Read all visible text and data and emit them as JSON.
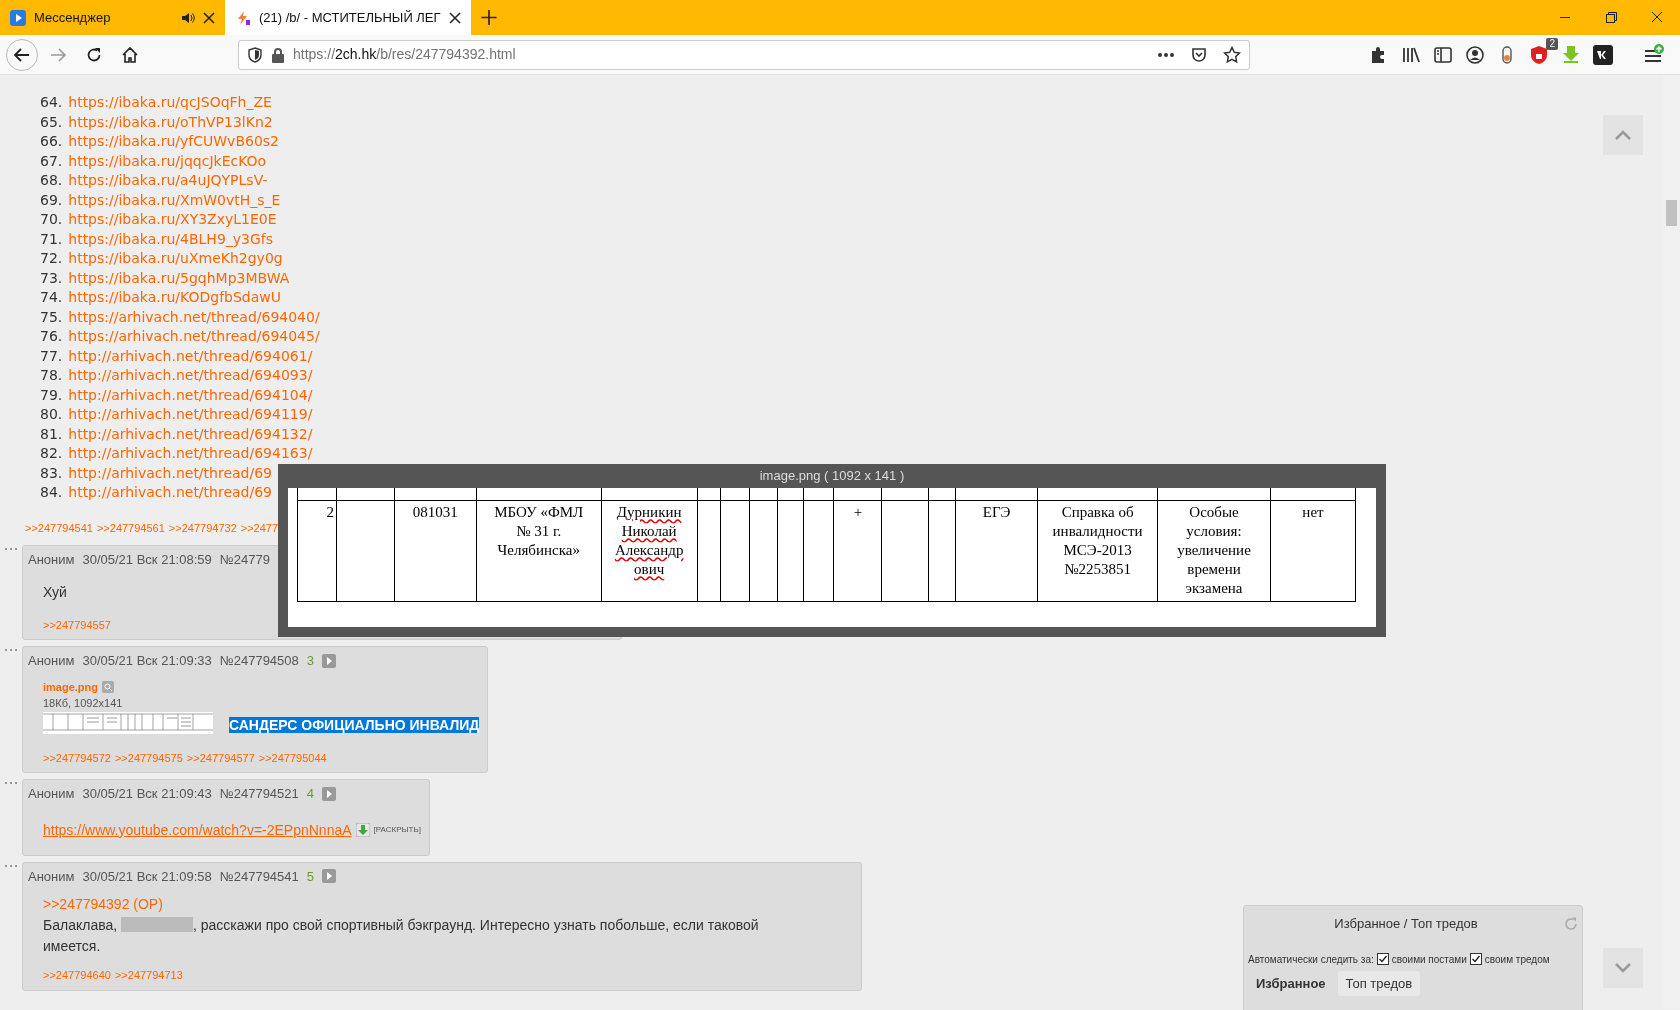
{
  "browser": {
    "tabs": [
      {
        "title": "Мессенджер",
        "selected": false,
        "audio": true
      },
      {
        "title": "(21) /b/ - МСТИТЕЛЬНЫЙ ЛЕГ",
        "selected": true,
        "audio": false
      }
    ],
    "url": {
      "scheme": "https://",
      "host": "2ch.hk",
      "path": "/b/res/247794392.html"
    },
    "extension_badge": "2"
  },
  "link_list": [
    {
      "number": "64.",
      "url": "https://ibaka.ru/qcJSOqFh_ZE"
    },
    {
      "number": "65.",
      "url": "https://ibaka.ru/oThVP13lKn2"
    },
    {
      "number": "66.",
      "url": "https://ibaka.ru/yfCUWvB60s2"
    },
    {
      "number": "67.",
      "url": "https://ibaka.ru/jqqcJkEcKOo"
    },
    {
      "number": "68.",
      "url": "https://ibaka.ru/a4uJQYPLsV-"
    },
    {
      "number": "69.",
      "url": "https://ibaka.ru/XmW0vtH_s_E"
    },
    {
      "number": "70.",
      "url": "https://ibaka.ru/XY3ZxyL1E0E"
    },
    {
      "number": "71.",
      "url": "https://ibaka.ru/4BLH9_y3Gfs"
    },
    {
      "number": "72.",
      "url": "https://ibaka.ru/uXmeKh2gy0g"
    },
    {
      "number": "73.",
      "url": "https://ibaka.ru/5gqhMp3MBWA"
    },
    {
      "number": "74.",
      "url": "https://ibaka.ru/KODgfbSdawU"
    },
    {
      "number": "75.",
      "url": "https://arhivach.net/thread/694040/"
    },
    {
      "number": "76.",
      "url": "https://arhivach.net/thread/694045/"
    },
    {
      "number": "77.",
      "url": "http://arhivach.net/thread/694061/"
    },
    {
      "number": "78.",
      "url": "http://arhivach.net/thread/694093/"
    },
    {
      "number": "79.",
      "url": "http://arhivach.net/thread/694104/"
    },
    {
      "number": "80.",
      "url": "http://arhivach.net/thread/694119/"
    },
    {
      "number": "81.",
      "url": "http://arhivach.net/thread/694132/"
    },
    {
      "number": "82.",
      "url": "http://arhivach.net/thread/694163/"
    },
    {
      "number": "83.",
      "url": "http://arhivach.net/thread/69"
    },
    {
      "number": "84.",
      "url": "http://arhivach.net/thread/69"
    }
  ],
  "op_replies": [
    ">>247794541",
    ">>247794561",
    ">>247794732",
    ">>2477"
  ],
  "posts": [
    {
      "author": "Аноним",
      "datetime": "30/05/21 Вск 21:08:59",
      "number": "№24779",
      "blocks": [
        {
          "kind": "text",
          "text": "Хуй"
        }
      ],
      "replies": [
        ">>247794557"
      ]
    },
    {
      "author": "Аноним",
      "datetime": "30/05/21 Вск 21:09:33",
      "number": "№247794508",
      "order": "3",
      "file": {
        "name": "image.png",
        "info": "18Кб, 1092x141"
      },
      "blocks": [
        {
          "kind": "highlight",
          "text": "САНДЕРС ОФИЦИАЛЬНО ИНВАЛИД"
        }
      ],
      "replies": [
        ">>247794572",
        ">>247794575",
        ">>247794577",
        ">>247795044"
      ]
    },
    {
      "author": "Аноним",
      "datetime": "30/05/21 Вск 21:09:43",
      "number": "№247794521",
      "order": "4",
      "blocks": [
        {
          "kind": "video_link",
          "url": "https://www.youtube.com/watch?v=-2EPpnNnnaA",
          "expand": "[РАСКРЫТЬ]"
        }
      ]
    },
    {
      "author": "Аноним",
      "datetime": "30/05/21 Вск 21:09:58",
      "number": "№247794541",
      "order": "5",
      "blocks": [
        {
          "kind": "quote_link",
          "text": ">>247794392 (OP)"
        },
        {
          "kind": "paragraph",
          "lines": [
            [
              {
                "kind": "text",
                "text": "Балаклава, "
              },
              {
                "kind": "spoiler"
              },
              {
                "kind": "text",
                "text": ", расскажи про свой спортивный бэкграунд. Интересно узнать побольше, если таковой"
              }
            ],
            [
              {
                "kind": "text",
                "text": "имеется."
              }
            ]
          ]
        }
      ],
      "replies": [
        ">>247794640",
        ">>247794713"
      ]
    }
  ],
  "image_viewer": {
    "title": "image.png ( 1092 x 141 )",
    "row": [
      {
        "kind": "text",
        "text": "2",
        "misspelled": false
      },
      {
        "kind": "empty"
      },
      {
        "kind": "text",
        "text": "081031",
        "misspelled": false
      },
      {
        "kind": "text",
        "text": "МБОУ «ФМЛ\n№ 31 г.\nЧелябинска»",
        "misspelled": false
      },
      {
        "kind": "text",
        "text": "Дурникин\nНиколай\nАлександр\nович",
        "misspelled": true
      },
      {
        "kind": "empty"
      },
      {
        "kind": "empty"
      },
      {
        "kind": "empty"
      },
      {
        "kind": "empty"
      },
      {
        "kind": "empty"
      },
      {
        "kind": "text",
        "text": "+",
        "misspelled": false
      },
      {
        "kind": "empty"
      },
      {
        "kind": "empty"
      },
      {
        "kind": "text",
        "text": "ЕГЭ",
        "misspelled": false
      },
      {
        "kind": "text",
        "text": "Справка об\nинвалидности\nМСЭ-2013\n№2253851",
        "misspelled": false
      },
      {
        "kind": "text",
        "text": "Особые\nусловия:\nувеличение\nвремени\nэкзамена",
        "misspelled": false
      },
      {
        "kind": "text",
        "text": "нет",
        "misspelled": false
      }
    ]
  },
  "favorites_panel": {
    "title": "Избранное / Топ тредов",
    "auto_watch_label": "Автоматически следить за:",
    "options": [
      {
        "label": "своими постами",
        "checked": true
      },
      {
        "label": "своим тредом",
        "checked": true
      }
    ],
    "tabs": [
      {
        "label": "Избранное",
        "selected": true
      },
      {
        "label": "Топ тредов",
        "selected": false
      }
    ]
  }
}
